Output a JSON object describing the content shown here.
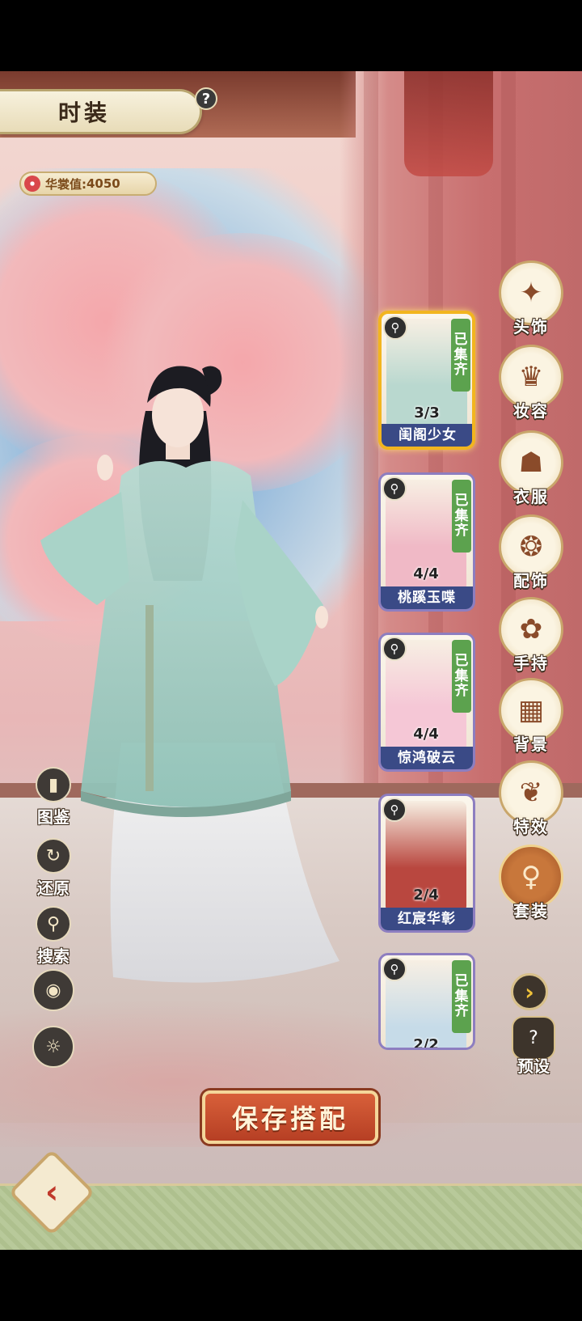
{
  "header": {
    "title": "时装",
    "help_icon": "?"
  },
  "stats": {
    "value_label": "华裳值:",
    "value": "4050"
  },
  "left_tools": [
    {
      "label": "图鉴",
      "icon": "book-icon",
      "glyph": "▮"
    },
    {
      "label": "还原",
      "icon": "restore-icon",
      "glyph": "↻"
    },
    {
      "label": "搜索",
      "icon": "search-icon",
      "glyph": "⚲"
    },
    {
      "label": "",
      "icon": "eye-icon",
      "glyph": "◉"
    },
    {
      "label": "",
      "icon": "day-night-icon",
      "glyph": "☼"
    }
  ],
  "outfits": [
    {
      "name": "闺阁少女",
      "count": "3/3",
      "collected": "已集齐",
      "selected": true,
      "tint": "#b9d8cf"
    },
    {
      "name": "桃蹊玉喋",
      "count": "4/4",
      "collected": "已集齐",
      "selected": false,
      "tint": "#f0b9c6"
    },
    {
      "name": "惊鸿破云",
      "count": "4/4",
      "collected": "已集齐",
      "selected": false,
      "tint": "#f5c7d6"
    },
    {
      "name": "红宸华彰",
      "count": "2/4",
      "collected": "",
      "selected": false,
      "tint": "#b9473f"
    },
    {
      "name": "",
      "count": "2/2",
      "collected": "已集齐",
      "selected": false,
      "tint": "#c6dbe8"
    }
  ],
  "categories": [
    {
      "label": "头饰",
      "glyph": "✦",
      "active": false
    },
    {
      "label": "妆容",
      "glyph": "♛",
      "active": false
    },
    {
      "label": "衣服",
      "glyph": "☗",
      "active": false
    },
    {
      "label": "配饰",
      "glyph": "❂",
      "active": false
    },
    {
      "label": "手持",
      "glyph": "✿",
      "active": false
    },
    {
      "label": "背景",
      "glyph": "▦",
      "active": false
    },
    {
      "label": "特效",
      "glyph": "❦",
      "active": false
    },
    {
      "label": "套装",
      "glyph": "♀",
      "active": true
    }
  ],
  "nav": {
    "next_glyph": "›",
    "preset_label": "预设",
    "preset_glyph": "?",
    "back_glyph": "‹"
  },
  "save": {
    "label": "保存搭配"
  }
}
